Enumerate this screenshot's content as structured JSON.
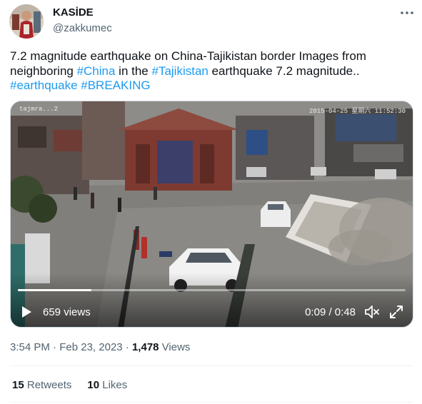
{
  "author": {
    "name": "KASİDE",
    "handle": "@zakkumec"
  },
  "tweet": {
    "line1": "7.2 magnitude earthquake on China-Tajikistan border Images from",
    "line2_pre": "neighboring ",
    "tag_china": "#China",
    "line2_mid": " in the ",
    "tag_tajikistan": "#Tajikistan",
    "line2_post": " earthquake 7.2 magnitude..",
    "tag_earthquake": "#earthquake",
    "tag_breaking": "#BREAKING"
  },
  "video": {
    "osd_left": "tajmra...2",
    "osd_right": "2015-04-25 星期六 11:52:30",
    "views": "659 views",
    "time": "0:09 / 0:48",
    "progress_fraction": 0.19
  },
  "meta": {
    "time": "3:54 PM",
    "separator1": " · ",
    "date": "Feb 23, 2023",
    "separator2": " · ",
    "views_count": "1,478",
    "views_label": " Views"
  },
  "stats": {
    "retweets_count": "15",
    "retweets_label": " Retweets",
    "likes_count": "10",
    "likes_label": " Likes"
  },
  "colors": {
    "link": "#1d9bf0",
    "secondary_text": "#536471"
  },
  "icons": {
    "more": "more-horizontal-icon",
    "play": "play-icon",
    "mute": "volume-muted-icon",
    "expand": "fullscreen-expand-icon"
  }
}
